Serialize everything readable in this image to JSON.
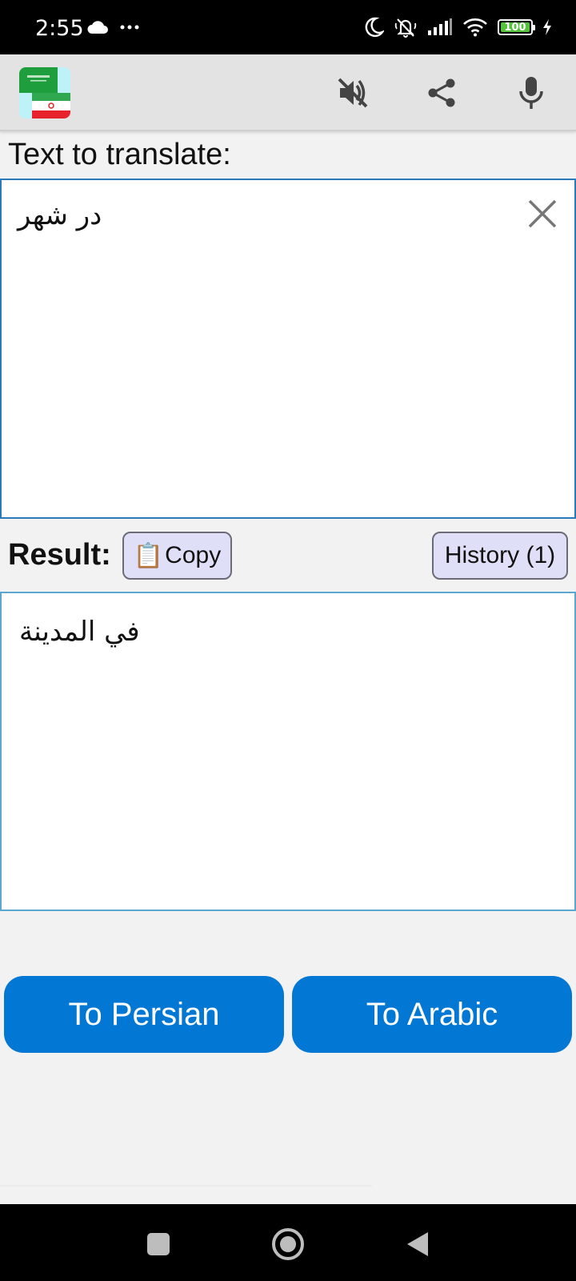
{
  "status_bar": {
    "time": "2:55",
    "battery_level": "100",
    "icons": [
      "cloud-icon",
      "more-dots-icon",
      "moon-icon",
      "silent-bell-icon",
      "signal-icon",
      "wifi-icon",
      "battery-icon",
      "charging-icon"
    ]
  },
  "app_bar": {
    "app_icon": "saudi-iran-flags-icon",
    "actions": [
      "volume-mute-icon",
      "share-icon",
      "microphone-icon"
    ]
  },
  "input": {
    "label": "Text to translate:",
    "value": "در شهر"
  },
  "result": {
    "label": "Result:",
    "value": "في المدينة",
    "copy_label": "Copy",
    "copy_icon": "📋",
    "history_label": "History (1)"
  },
  "actions": {
    "to_persian": "To Persian",
    "to_arabic": "To Arabic"
  },
  "colors": {
    "primary": "#0278d4",
    "border": "#2a7ab9",
    "secondary_button": "#dfe0f8",
    "background": "#f2f2f2"
  }
}
